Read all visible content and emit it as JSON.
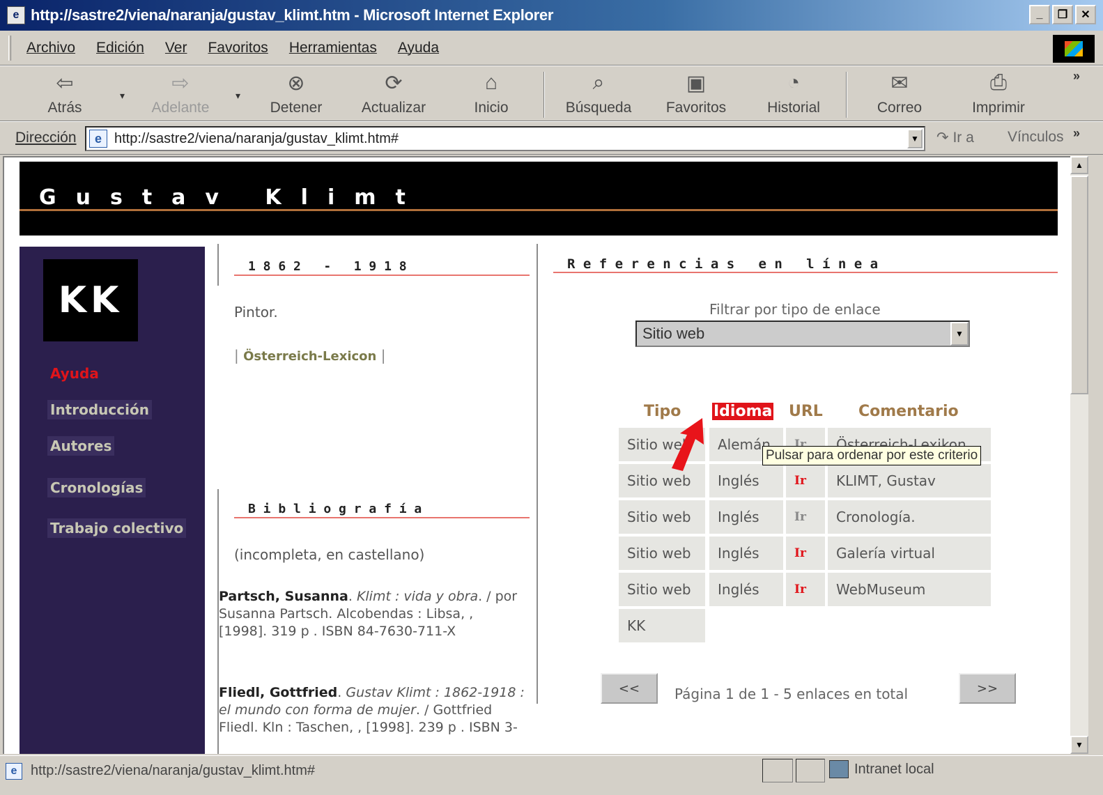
{
  "window": {
    "title": "http://sastre2/viena/naranja/gustav_klimt.htm - Microsoft Internet Explorer",
    "controls": [
      "_",
      "❐",
      "✕"
    ]
  },
  "menu": [
    "Archivo",
    "Edición",
    "Ver",
    "Favoritos",
    "Herramientas",
    "Ayuda"
  ],
  "toolbar": {
    "back": "Atrás",
    "forward": "Adelante",
    "stop": "Detener",
    "refresh": "Actualizar",
    "home": "Inicio",
    "search": "Búsqueda",
    "favorites": "Favoritos",
    "history": "Historial",
    "mail": "Correo",
    "print": "Imprimir"
  },
  "address": {
    "label": "Dirección",
    "url": "http://sastre2/viena/naranja/gustav_klimt.htm#",
    "go": "Ir a",
    "links": "Vínculos"
  },
  "page": {
    "banner_title": "Gustav Klimt",
    "logo": "KK",
    "nav": [
      "Ayuda",
      "Introducción",
      "Autores",
      "Cronologías",
      "Trabajo colectivo"
    ],
    "dates_heading": "1 8 6 2   -   1 9 1 8",
    "role": "Pintor.",
    "lexicon_link": "Österreich-Lexicon",
    "bib_heading": "B i b l i o g r a f í a",
    "bib_note": "(incompleta, en castellano)",
    "bib": [
      {
        "author": "Partsch, Susanna",
        "title": "Klimt : vida y obra",
        "rest": ". / por Susanna Partsch. Alcobendas : Libsa, , [1998]. 319 p . ISBN 84-7630-711-X"
      },
      {
        "author": "Fliedl, Gottfried",
        "title": "Gustav Klimt : 1862-1918 : el mundo con forma de mujer",
        "rest": ". / Gottfried Fliedl. Kln : Taschen, , [1998]. 239 p . ISBN 3-"
      }
    ],
    "refs_heading": "R e f e r e n c i a s   e n   l í n e a",
    "filter_label": "Filtrar por tipo de enlace",
    "filter_value": "Sitio web",
    "table_headers": [
      "Tipo",
      "Idioma",
      "URL",
      "Comentario"
    ],
    "rows": [
      {
        "tipo": "Sitio web",
        "idioma": "Alemán",
        "url": "Ir",
        "comentario": "Österreich-Lexikon"
      },
      {
        "tipo": "Sitio web",
        "idioma": "Inglés",
        "url": "Ir",
        "comentario": "KLIMT, Gustav"
      },
      {
        "tipo": "Sitio web",
        "idioma": "Inglés",
        "url": "Ir",
        "comentario": "Cronología."
      },
      {
        "tipo": "Sitio web",
        "idioma": "Inglés",
        "url": "Ir",
        "comentario": "Galería virtual"
      },
      {
        "tipo": "Sitio web",
        "idioma": "Inglés",
        "url": "Ir",
        "comentario": "WebMuseum"
      }
    ],
    "kk_cell": "KK",
    "tooltip": "Pulsar para ordenar por este criterio",
    "prev": "<<",
    "next": ">>",
    "pagination": "Página 1 de 1 - 5 enlaces en total"
  },
  "status": {
    "url": "http://sastre2/viena/naranja/gustav_klimt.htm#",
    "zone": "Intranet local"
  },
  "colors": {
    "accent_red": "#e0141a",
    "nav_bg": "#2b1f4d",
    "banner_bg": "#000000",
    "header_text": "#a07a4a"
  }
}
